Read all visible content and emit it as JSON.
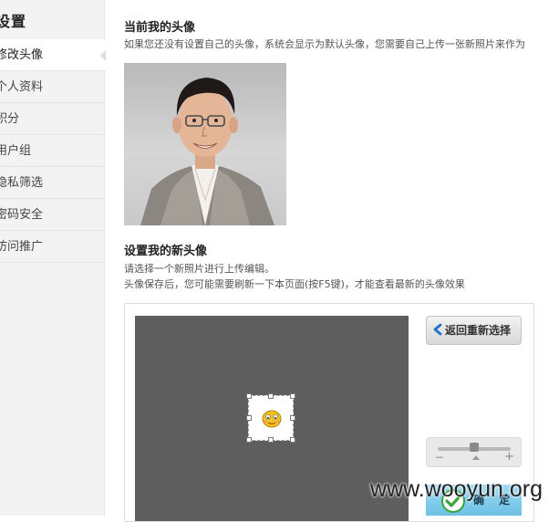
{
  "sidebar": {
    "title": "设置",
    "items": [
      {
        "label": "修改头像",
        "active": true
      },
      {
        "label": "个人资料",
        "active": false
      },
      {
        "label": "积分",
        "active": false
      },
      {
        "label": "用户组",
        "active": false
      },
      {
        "label": "隐私筛选",
        "active": false
      },
      {
        "label": "密码安全",
        "active": false
      },
      {
        "label": "访问推广",
        "active": false
      }
    ]
  },
  "current_avatar": {
    "title": "当前我的头像",
    "hint": "如果您还没有设置自己的头像，系统会显示为默认头像，您需要自己上传一张新照片来作为"
  },
  "new_avatar": {
    "title": "设置我的新头像",
    "hint_line1": "请选择一个新照片进行上传编辑。",
    "hint_line2": "头像保存后，您可能需要刷新一下本页面(按F5键)，才能查看最新的头像效果"
  },
  "editor": {
    "back_label": "返回重新选择",
    "confirm_label": "确 定",
    "zoom_minus": "−",
    "zoom_plus": "+",
    "zoom_level": 0.5,
    "crop_icon": "emoticon-face-icon"
  },
  "watermark": "www.wooyun.org",
  "colors": {
    "sidebar_bg": "#f3f3f3",
    "canvas_bg": "#5e5e5e",
    "confirm_bg": "#6cc1e6",
    "check_green": "#3aa63a"
  }
}
